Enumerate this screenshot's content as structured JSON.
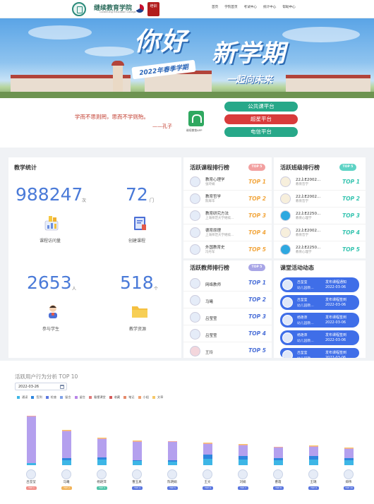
{
  "header": {
    "logo_title": "继续教育学院",
    "logo_subtitle": "Continuing Education College",
    "logo_seal_text": "培训",
    "nav": [
      "首页",
      "学院首页",
      "考试中心",
      "统计中心",
      "帮助中心"
    ]
  },
  "banner": {
    "hello": "你好",
    "new_term": "新学期",
    "spring": "2022年春季学期",
    "together": "一起向未来"
  },
  "quote": {
    "text": "学而不思则罔，思而不学则殆。",
    "author": "——孔子"
  },
  "app": {
    "label": "继续教育APP"
  },
  "platforms": [
    {
      "label": "公共课平台",
      "color": "#27a889"
    },
    {
      "label": "超星平台",
      "color": "#d83b3b"
    },
    {
      "label": "电信平台",
      "color": "#27a889"
    }
  ],
  "teaching_stats": {
    "title": "教学统计",
    "items": [
      {
        "value": "988247",
        "unit": "次",
        "label": "课程访问量",
        "icon": "bar-chart-icon"
      },
      {
        "value": "72",
        "unit": "门",
        "label": "创建课程",
        "icon": "course-book-icon"
      },
      {
        "value": "2653",
        "unit": "人",
        "label": "参与学生",
        "icon": "student-icon"
      },
      {
        "value": "518",
        "unit": "个",
        "label": "教学资源",
        "icon": "folder-icon"
      }
    ]
  },
  "course_rank": {
    "title": "活跃课程排行榜",
    "badge": "TOP 5",
    "badge_color": "#f2a0a0",
    "items": [
      {
        "name": "教育心理学",
        "sub": "张玲娟",
        "rank": "TOP 1"
      },
      {
        "name": "教育哲学",
        "sub": "陈辉华",
        "rank": "TOP 2"
      },
      {
        "name": "教育研究方法",
        "sub": "上海师范大学继续...",
        "rank": "TOP 3"
      },
      {
        "name": "德育原理",
        "sub": "上海师范大学继续...",
        "rank": "TOP 4"
      },
      {
        "name": "外国教育史",
        "sub": "冯丹军",
        "rank": "TOP 5"
      }
    ]
  },
  "class_rank": {
    "title": "活跃班级排行榜",
    "badge": "TOP 5",
    "badge_color": "#5ed3c5",
    "items": [
      {
        "name": "22上E2002...",
        "sub": "教育哲学",
        "rank": "TOP 1"
      },
      {
        "name": "22上E2002...",
        "sub": "教育哲学",
        "rank": "TOP 2"
      },
      {
        "name": "22上E2250...",
        "sub": "教育心理学",
        "rank": "TOP 3"
      },
      {
        "name": "22上E2002...",
        "sub": "教育哲学",
        "rank": "TOP 4"
      },
      {
        "name": "22上E2250...",
        "sub": "教育心理学",
        "rank": "TOP 5"
      }
    ]
  },
  "teacher_rank": {
    "title": "活跃教师排行榜",
    "badge": "TOP 5",
    "badge_color": "#a8a5e6",
    "items": [
      {
        "name": "网络教师",
        "rank": "TOP 1"
      },
      {
        "name": "马曦",
        "rank": "TOP 2"
      },
      {
        "name": "吕莹莹",
        "rank": "TOP 3"
      },
      {
        "name": "吕莹莹",
        "rank": "TOP 4"
      },
      {
        "name": "王玲",
        "rank": "TOP 5"
      }
    ]
  },
  "class_activity": {
    "title": "课堂活动动态",
    "items": [
      {
        "who": "吕莹莹",
        "cls": "幼儿园教...",
        "what": "发布课程通知",
        "when": "2022-03-06"
      },
      {
        "who": "吕莹莹",
        "cls": "幼儿园教...",
        "what": "发布课程签到",
        "when": "2022-03-06"
      },
      {
        "who": "杨艳萍",
        "cls": "幼儿园教...",
        "what": "发布课程签到",
        "when": "2022-03-06"
      },
      {
        "who": "杨艳萍",
        "cls": "幼儿园教...",
        "what": "发布课程签到",
        "when": "2022-03-06"
      },
      {
        "who": "吕莹莹",
        "cls": "幼儿园教...",
        "what": "发布课程签到",
        "when": "2022-03-06"
      }
    ]
  },
  "rank_colors": [
    "#f2a63d",
    "#f2a63d",
    "#f2a63d",
    "#f2a63d",
    "#f2a63d"
  ],
  "class_rank_color": "#36c4b0",
  "teacher_rank_color": "#4a6fd8",
  "behavior": {
    "title": "活跃用户行为分析 TOP 10",
    "date": "2022-03-26",
    "legend": [
      {
        "label": "通读",
        "color": "#3db6e6"
      },
      {
        "label": "签到",
        "color": "#2e86de"
      },
      {
        "label": "检查",
        "color": "#5b77e0"
      },
      {
        "label": "留言",
        "color": "#7fa2e8"
      },
      {
        "label": "留言",
        "color": "#b884e8"
      },
      {
        "label": "看懂课堂",
        "color": "#e07a7a"
      },
      {
        "label": "收藏",
        "color": "#d45a5a"
      },
      {
        "label": "笔记",
        "color": "#e58a6a"
      },
      {
        "label": "小组",
        "color": "#f0a070"
      },
      {
        "label": "文章",
        "color": "#f5c868"
      }
    ],
    "users": [
      {
        "name": "吕莹莹",
        "top": "TOP 1",
        "top_color": "#f2908a"
      },
      {
        "name": "马曦",
        "top": "TOP 2",
        "top_color": "#f2b45a"
      },
      {
        "name": "杨艳萍",
        "top": "TOP 3",
        "top_color": "#4fc4a8"
      },
      {
        "name": "曹玉真",
        "top": "TOP 4",
        "top_color": "#5b77e0"
      },
      {
        "name": "陈明娟",
        "top": "TOP 5",
        "top_color": "#5b77e0"
      },
      {
        "name": "王文",
        "top": "TOP 6",
        "top_color": "#5b77e0"
      },
      {
        "name": "刘娟",
        "top": "TOP 7",
        "top_color": "#5b77e0"
      },
      {
        "name": "曹霞",
        "top": "TOP 8",
        "top_color": "#5b77e0"
      },
      {
        "name": "王璐",
        "top": "TOP 9",
        "top_color": "#5b77e0"
      },
      {
        "name": "郑伟",
        "top": "TOP 10",
        "top_color": "#5b77e0"
      }
    ]
  },
  "chart_data": {
    "type": "bar",
    "title": "活跃用户行为分析 TOP 10",
    "categories": [
      "吕莹莹",
      "马曦",
      "杨艳萍",
      "曹玉真",
      "陈明娟",
      "王文",
      "刘娟",
      "曹霞",
      "王璐",
      "郑伟"
    ],
    "series": [
      {
        "name": "通读",
        "values": [
          3,
          8,
          9,
          6,
          5,
          10,
          9,
          7,
          9,
          7
        ]
      },
      {
        "name": "签到",
        "values": [
          0,
          3,
          3,
          2,
          2,
          6,
          5,
          4,
          5,
          4
        ]
      },
      {
        "name": "留言",
        "values": [
          71,
          40,
          28,
          27,
          28,
          16,
          16,
          16,
          14,
          14
        ]
      },
      {
        "name": "看懂课堂",
        "values": [
          1,
          1,
          1,
          1,
          1,
          1,
          1,
          1,
          1,
          1
        ]
      },
      {
        "name": "文章",
        "values": [
          0,
          1,
          1,
          1,
          0,
          1,
          1,
          0,
          1,
          1
        ]
      }
    ],
    "ylim": [
      0,
      80
    ],
    "grid": false,
    "legend": "top-left"
  }
}
